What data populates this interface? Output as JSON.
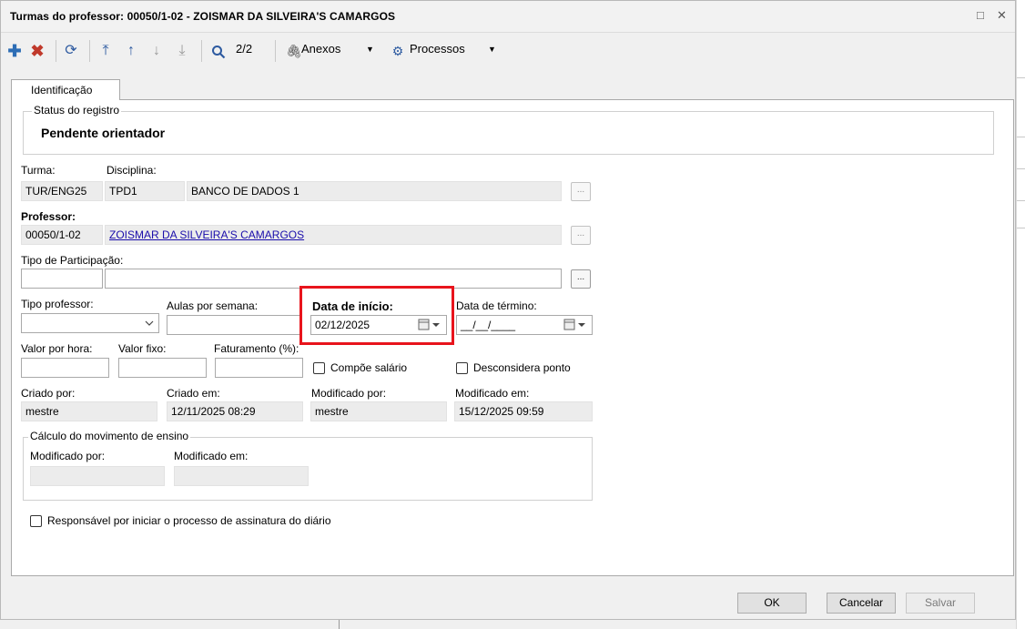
{
  "window": {
    "title": "Turmas do professor: 00050/1-02 - ZOISMAR DA SILVEIRA'S CAMARGOS",
    "maximize_glyph": "□",
    "close_glyph": "✕"
  },
  "toolbar": {
    "record_counter": "2/2",
    "attachments_label": "Anexos",
    "processes_label": "Processos",
    "dropdown_glyph": "▼"
  },
  "tabs": [
    "Identificação"
  ],
  "status": {
    "legend": "Status do registro",
    "value": "Pendente orientador"
  },
  "fields": {
    "turma": {
      "label": "Turma:",
      "value": "TUR/ENG25"
    },
    "disciplina": {
      "label": "Disciplina:",
      "code": "TPD1",
      "name": "BANCO DE DADOS 1"
    },
    "professor": {
      "label": "Professor:",
      "code": "00050/1-02",
      "name": "ZOISMAR DA SILVEIRA'S CAMARGOS"
    },
    "tipo_participacao": {
      "label": "Tipo de Participação:",
      "code": "",
      "name": ""
    },
    "tipo_professor": {
      "label": "Tipo professor:",
      "value": ""
    },
    "aulas_semana": {
      "label": "Aulas por semana:",
      "value": ""
    },
    "data_inicio": {
      "label": "Data de início:",
      "value": "02/12/2025"
    },
    "data_termino": {
      "label": "Data de término:",
      "value": "__/__/____"
    },
    "valor_hora": {
      "label": "Valor por hora:",
      "value": ""
    },
    "valor_fixo": {
      "label": "Valor fixo:",
      "value": ""
    },
    "faturamento": {
      "label": "Faturamento (%):",
      "value": ""
    },
    "compoe_salario": {
      "label": "Compõe salário",
      "checked": false
    },
    "desconsidera_ponto": {
      "label": "Desconsidera ponto",
      "checked": false
    },
    "criado_por": {
      "label": "Criado por:",
      "value": "mestre"
    },
    "criado_em": {
      "label": "Criado em:",
      "value": "12/11/2025 08:29"
    },
    "modificado_por": {
      "label": "Modificado por:",
      "value": "mestre"
    },
    "modificado_em": {
      "label": "Modificado em:",
      "value": "15/12/2025 09:59"
    }
  },
  "calculo": {
    "legend": "Cálculo do movimento de ensino",
    "modificado_por": {
      "label": "Modificado por:",
      "value": ""
    },
    "modificado_em": {
      "label": "Modificado em:",
      "value": ""
    }
  },
  "responsavel": {
    "label": "Responsável por iniciar o processo de assinatura do diário",
    "checked": false
  },
  "lookup_glyph": "...",
  "buttons": {
    "ok": "OK",
    "cancel": "Cancelar",
    "save": "Salvar"
  },
  "colors": {
    "highlight": "#e8141c",
    "toolbar_blue": "#2d5aa0",
    "delete_red": "#c0392b",
    "link": "#1a0dab"
  }
}
